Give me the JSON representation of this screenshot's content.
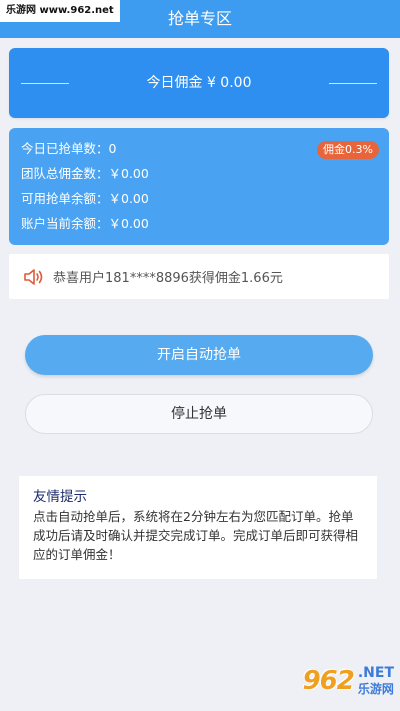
{
  "watermark": {
    "top_text": "乐游网 www.962.net",
    "logo": "962",
    "net": ".NET",
    "site_name": "乐游网"
  },
  "header": {
    "title": "抢单专区"
  },
  "commission": {
    "text": "今日佣金 ¥  0.00"
  },
  "stats": {
    "badge": "佣金0.3%",
    "rows": [
      "今日已抢单数：0",
      "团队总佣金数：￥0.00",
      "可用抢单余额：￥0.00",
      "账户当前余额：￥0.00"
    ]
  },
  "notice": {
    "icon": "speaker-icon",
    "text": "恭喜用户181****8896获得佣金1.66元"
  },
  "buttons": {
    "start": "开启自动抢单",
    "stop": "停止抢单"
  },
  "tips": {
    "title": "友情提示",
    "body": "点击自动抢单后，系统将在2分钟左右为您匹配订单。抢单成功后请及时确认并提交完成订单。完成订单后即可获得相应的订单佣金！"
  },
  "colors": {
    "header": "#3d9bf0",
    "card": "#2e8ff0",
    "stats": "#4aa3f2",
    "badge": "#e8643a",
    "start_button": "#55aaf0"
  }
}
